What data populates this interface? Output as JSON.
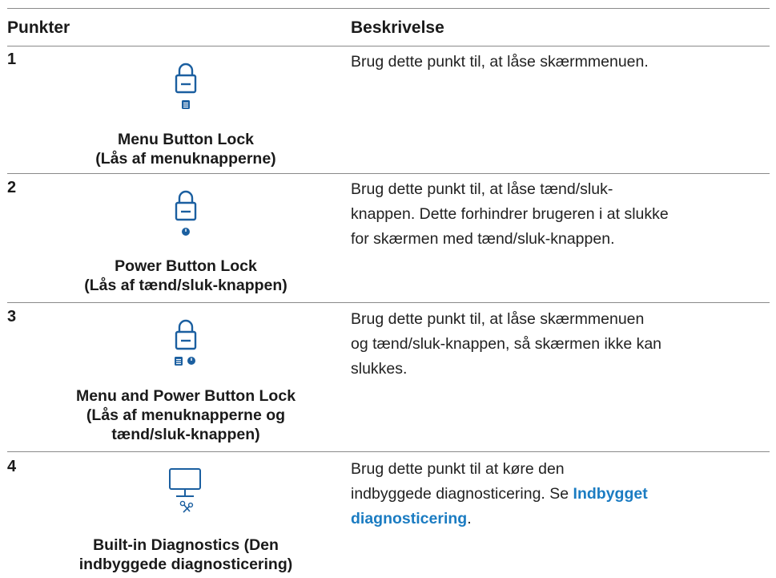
{
  "header": {
    "col1": "Punkter",
    "col2": "Beskrivelse"
  },
  "rows": [
    {
      "num": "1",
      "icon": "lock-menu-icon",
      "name_line1": "Menu Button Lock",
      "name_line2": "(Lås af menuknapperne)",
      "desc": "Brug dette punkt til, at låse skærmmenuen."
    },
    {
      "num": "2",
      "icon": "lock-power-icon",
      "name_line1": "Power Button Lock",
      "name_line2": "(Lås af tænd/sluk-knappen)",
      "desc_l1": "Brug dette punkt til, at låse tænd/sluk-",
      "desc_l2": "knappen. Dette forhindrer brugeren i at slukke",
      "desc_l3": "for skærmen med tænd/sluk-knappen."
    },
    {
      "num": "3",
      "icon": "lock-menu-power-icon",
      "name_line1": "Menu and Power Button Lock",
      "name_line2": "(Lås af menuknapperne og",
      "name_line3": "tænd/sluk-knappen)",
      "desc_l1": "Brug dette punkt til, at låse skærmmenuen",
      "desc_l2": "og tænd/sluk-knappen, så skærmen ikke kan",
      "desc_l3": "slukkes."
    },
    {
      "num": "4",
      "icon": "monitor-diagnostics-icon",
      "name_line1": "Built-in Diagnostics (Den",
      "name_line2": "indbyggede diagnosticering)",
      "desc_l1": "Brug dette punkt til at køre den",
      "desc_l2_pre": "indbyggede diagnosticering. Se ",
      "desc_l2_link": "Indbygget",
      "desc_l3_link": "diagnosticering",
      "desc_l3_post": "."
    }
  ],
  "colors": {
    "icon": "#1b5fa0",
    "link": "#1b7cc2",
    "rule": "#8a8a8a"
  }
}
